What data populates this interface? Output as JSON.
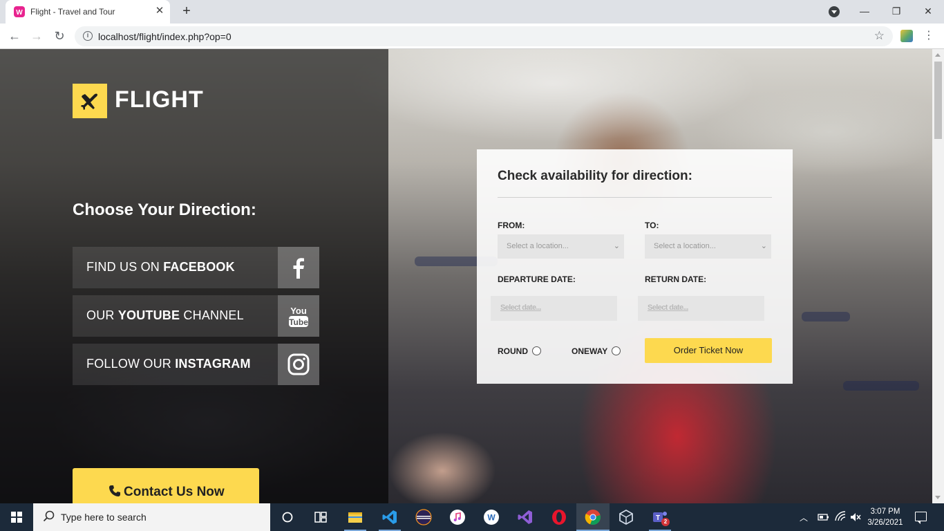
{
  "browser": {
    "tab_title": "Flight - Travel and Tour",
    "url": "localhost/flight/index.php?op=0"
  },
  "brand": {
    "logo_text": "FLIGHT",
    "accent": "#fdd94f"
  },
  "left_panel": {
    "heading": "Choose Your Direction:",
    "social": [
      {
        "pre": "FIND US ON ",
        "bold": "FACEBOOK",
        "post": "",
        "icon": "facebook-icon"
      },
      {
        "pre": "OUR ",
        "bold": "YOUTUBE",
        "post": " CHANNEL",
        "icon": "youtube-icon"
      },
      {
        "pre": "FOLLOW OUR ",
        "bold": "INSTAGRAM",
        "post": "",
        "icon": "instagram-icon"
      }
    ],
    "contact_label": "Contact Us Now"
  },
  "booking": {
    "title": "Check availability for direction:",
    "from_label": "FROM:",
    "to_label": "TO:",
    "from_placeholder": "Select a location...",
    "to_placeholder": "Select a location...",
    "departure_label": "DEPARTURE DATE:",
    "return_label": "RETURN DATE:",
    "departure_placeholder": "Select date...",
    "return_placeholder": "Select date...",
    "round_label": "ROUND",
    "oneway_label": "ONEWAY",
    "order_label": "Order Ticket Now"
  },
  "taskbar": {
    "search_placeholder": "Type here to search",
    "time": "3:07 PM",
    "date": "3/26/2021",
    "teams_badge": "2"
  }
}
